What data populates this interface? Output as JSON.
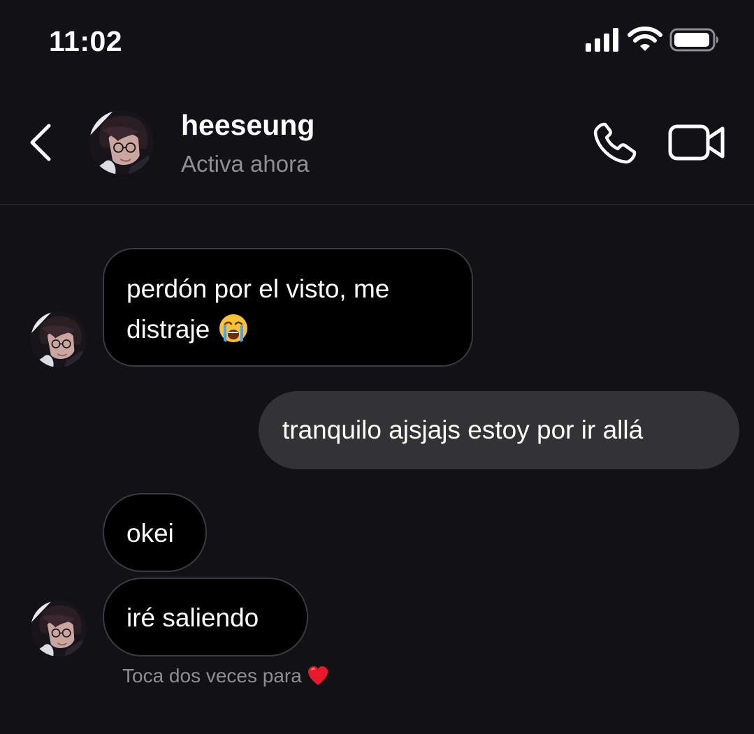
{
  "status_bar": {
    "time": "11:02",
    "icons": [
      "cellular-signal-icon",
      "wifi-icon",
      "battery-icon"
    ]
  },
  "header": {
    "back_icon": "chevron-left-icon",
    "contact_name": "heeseung",
    "presence": "Activa ahora",
    "actions": [
      "phone-icon",
      "video-camera-icon"
    ]
  },
  "messages": [
    {
      "direction": "incoming",
      "text": "perdón por el visto, me\ndistraje",
      "emoji": "loudly-crying-face-emoji"
    },
    {
      "direction": "outgoing",
      "text": "tranquilo ajsjajs estoy por ir allá"
    },
    {
      "direction": "incoming",
      "text": "okei"
    },
    {
      "direction": "incoming",
      "text": "iré saliendo"
    }
  ],
  "hint": {
    "text": "Toca dos veces para",
    "icon": "red-heart-icon"
  },
  "colors": {
    "background": "#111116",
    "incoming_bubble": "#000000",
    "incoming_border": "#3a3a3f",
    "outgoing_bubble": "#333336",
    "secondary_text": "#8e8e93",
    "heart": "#e8192c"
  }
}
